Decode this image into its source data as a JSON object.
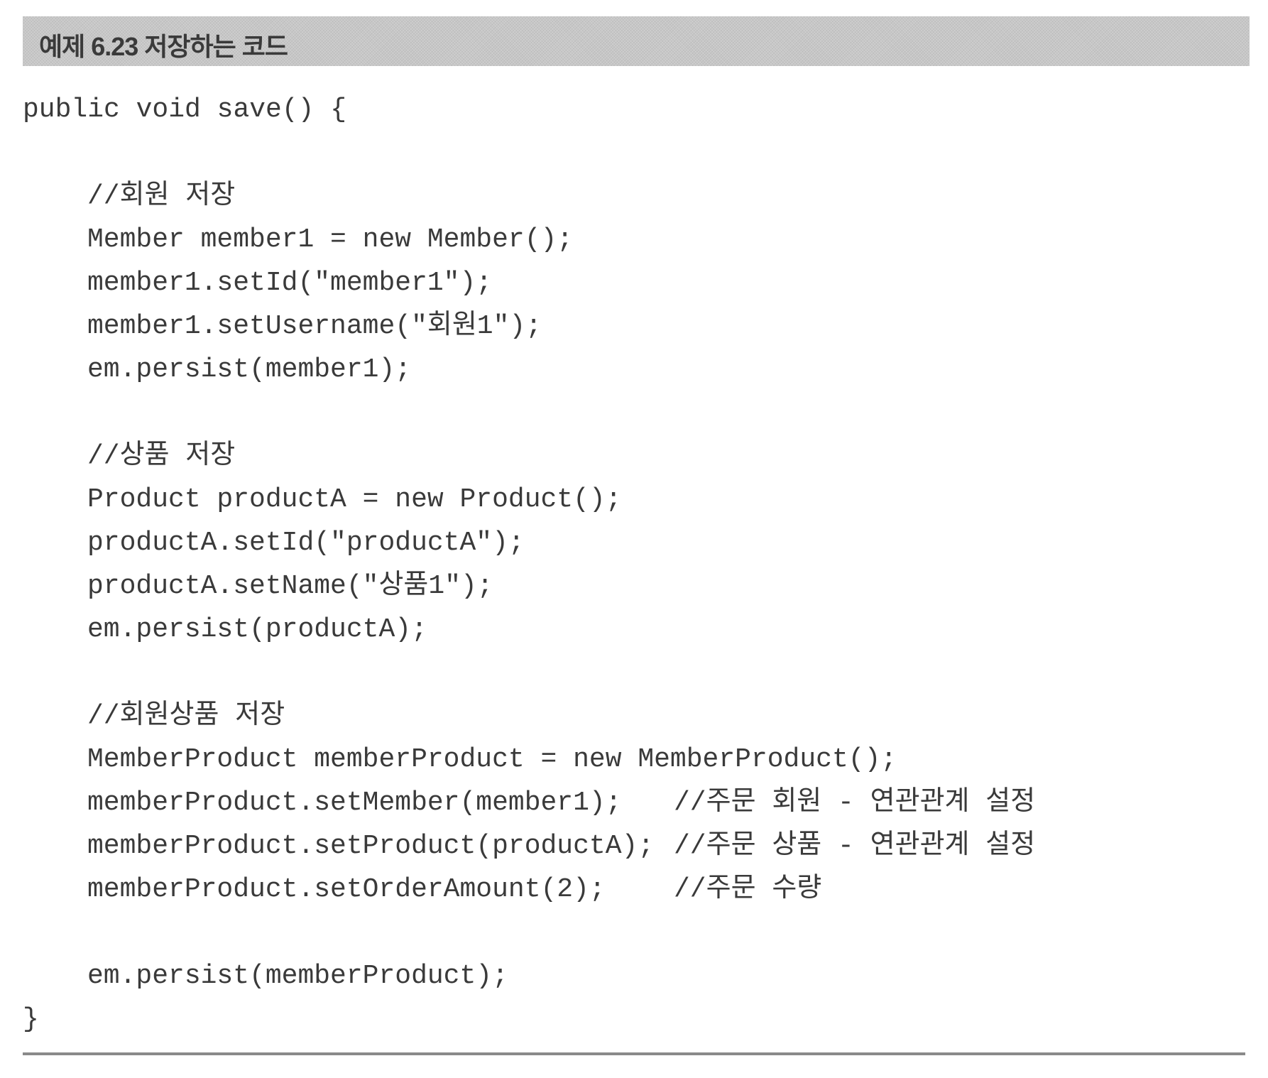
{
  "header": {
    "title": "예제 6.23 저장하는 코드"
  },
  "code": {
    "lines": [
      "public void save() {",
      "//회원 저장",
      "Member member1 = new Member();",
      "member1.setId(\"member1\");",
      "member1.setUsername(\"회원1\");",
      "em.persist(member1);",
      "//상품 저장",
      "Product productA = new Product();",
      "productA.setId(\"productA\");",
      "productA.setName(\"상품1\");",
      "em.persist(productA);",
      "//회원상품 저장",
      "MemberProduct memberProduct = new MemberProduct();",
      "memberProduct.setMember(member1);",
      "memberProduct.setProduct(productA);",
      "memberProduct.setOrderAmount(2);",
      "em.persist(memberProduct);",
      "}"
    ],
    "comments": [
      "//주문 회원 - 연관관계 설정",
      "//주문 상품 - 연관관계 설정",
      "//주문 수량"
    ]
  }
}
